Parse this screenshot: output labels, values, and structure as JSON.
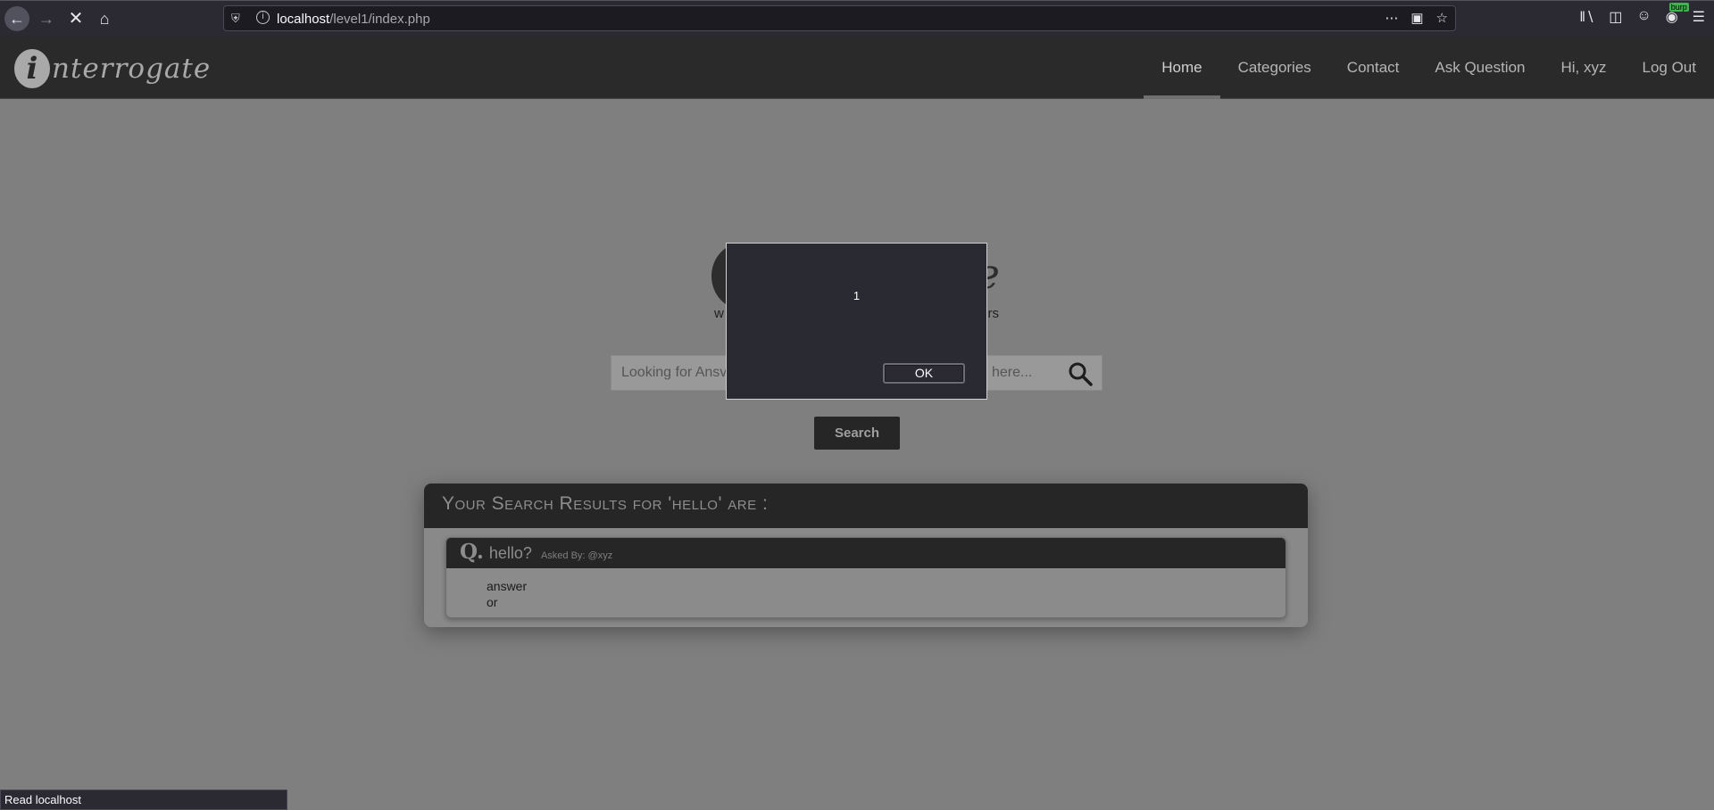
{
  "browser": {
    "url_host": "localhost",
    "url_path": "/level1/index.php",
    "burp_badge": "burp",
    "status_text": "Read localhost"
  },
  "site": {
    "logo_initial": "i",
    "logo_rest": "nterrogate",
    "nav": [
      "Home",
      "Categories",
      "Contact",
      "Ask Question",
      "Hi, xyz",
      "Log Out"
    ],
    "active_nav": "Home"
  },
  "hero": {
    "logo_tail": "e",
    "tagline_left": "w",
    "tagline_right": "rs",
    "search_placeholder_left": "Looking for Ansv",
    "search_placeholder_right": "here...",
    "search_button": "Search"
  },
  "results": {
    "heading": "Your Search Results for 'hello' are :",
    "items": [
      {
        "q_mark": "Q.",
        "title": "hello?",
        "asked_by": "Asked By: @xyz",
        "answer_line1": "answer",
        "answer_line2": "or"
      }
    ]
  },
  "alert": {
    "message": "1",
    "ok_label": "OK"
  }
}
